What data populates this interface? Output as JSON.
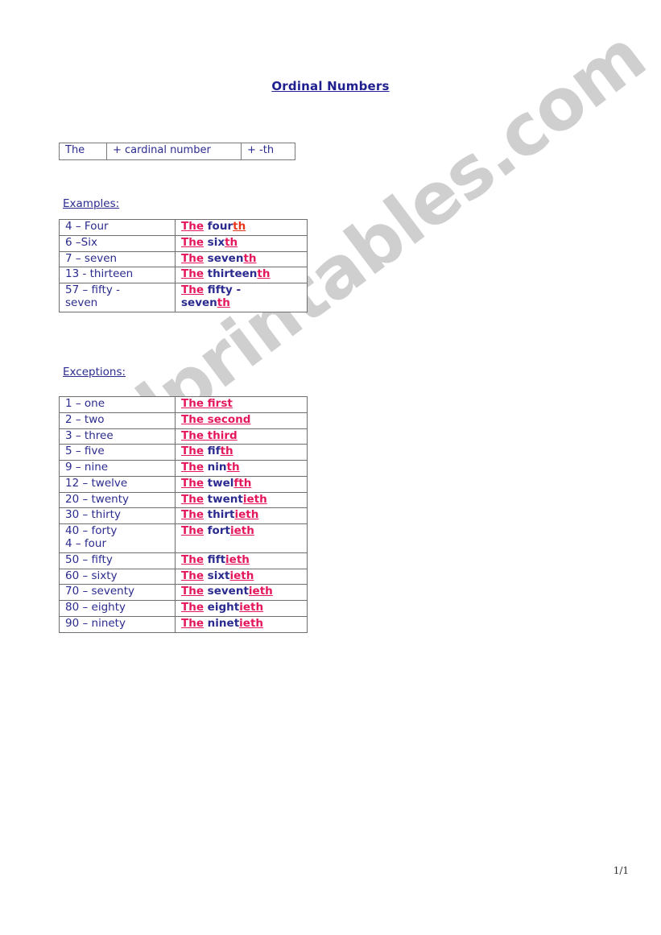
{
  "document": {
    "title": "Ordinal Numbers",
    "page_number": "1/1",
    "watermark": "eslprintables.com",
    "colors": {
      "navy": "#2b2b8f",
      "title_navy": "#1f1f8f",
      "pink": "#e4175c",
      "red": "#e8361a",
      "watermark_gray": "#cfcfcf",
      "table_border": "#6e6e6e"
    }
  },
  "formula": {
    "cell1": "The",
    "cell2": "+ cardinal number",
    "cell3": "+  -th"
  },
  "examples": {
    "heading": "Examples:",
    "rows": [
      {
        "number": "4 – Four",
        "the": "The",
        "stem": " four",
        "suffix": "th",
        "suffix_color": "red",
        "line2_stem": "",
        "line2_suffix": ""
      },
      {
        "number": "6 –Six",
        "the": "The",
        "stem": " six",
        "suffix": "th",
        "suffix_color": "pink",
        "line2_stem": "",
        "line2_suffix": ""
      },
      {
        "number": "7 – seven",
        "the": "The",
        "stem": " seven",
        "suffix": "th",
        "suffix_color": "pink",
        "line2_stem": "",
        "line2_suffix": ""
      },
      {
        "number": "13 - thirteen",
        "the": "The",
        "stem": " thirteen",
        "suffix": "th",
        "suffix_color": "pink",
        "line2_stem": "",
        "line2_suffix": ""
      },
      {
        "number": "57 – fifty -",
        "number_line2": "seven",
        "the": "The",
        "stem": " fifty -",
        "suffix": "",
        "suffix_color": "pink",
        "line2_stem": "seven",
        "line2_suffix": "th"
      }
    ]
  },
  "exceptions": {
    "heading": "Exceptions:",
    "rows": [
      {
        "number": "1 – one",
        "the": "The",
        "stem": "",
        "whole": "The first",
        "style": "all-pink"
      },
      {
        "number": "2 – two",
        "the": "The",
        "stem": "",
        "whole": "The second",
        "style": "all-pink"
      },
      {
        "number": "3 – three",
        "the": "The",
        "stem": "",
        "whole": "The third",
        "style": "all-pink"
      },
      {
        "number": "5 – five",
        "the": "The",
        "stem": " fif",
        "suffix": "th",
        "style": "split"
      },
      {
        "number": "9 – nine",
        "the": "The",
        "stem": " nin",
        "suffix": "th",
        "style": "split"
      },
      {
        "number": "12 – twelve",
        "the": "The",
        "stem": " twel",
        "suffix": "fth",
        "style": "split"
      },
      {
        "number": "20 – twenty",
        "the": "The",
        "stem": " twent",
        "suffix": "ieth",
        "style": "split"
      },
      {
        "number": "30 – thirty",
        "the": "The",
        "stem": " thirt",
        "suffix": "ieth",
        "style": "split"
      },
      {
        "number": "40 – forty",
        "number_line2": "4 – four",
        "the": "The",
        "stem": " fort",
        "suffix": "ieth",
        "style": "split"
      },
      {
        "number": "50 – fifty",
        "the": "The",
        "stem": " fift",
        "suffix": "ieth",
        "style": "split"
      },
      {
        "number": "60 – sixty",
        "the": "The",
        "stem": " sixt",
        "suffix": "ieth",
        "style": "split"
      },
      {
        "number": "70 – seventy",
        "the": "The",
        "stem": " sevent",
        "suffix": "ieth",
        "style": "split"
      },
      {
        "number": "80 – eighty",
        "the": "The",
        "stem": " eight",
        "suffix": "ieth",
        "style": "split"
      },
      {
        "number": "90 – ninety",
        "the": "The",
        "stem": " ninet",
        "suffix": "ieth",
        "style": "split"
      }
    ]
  }
}
